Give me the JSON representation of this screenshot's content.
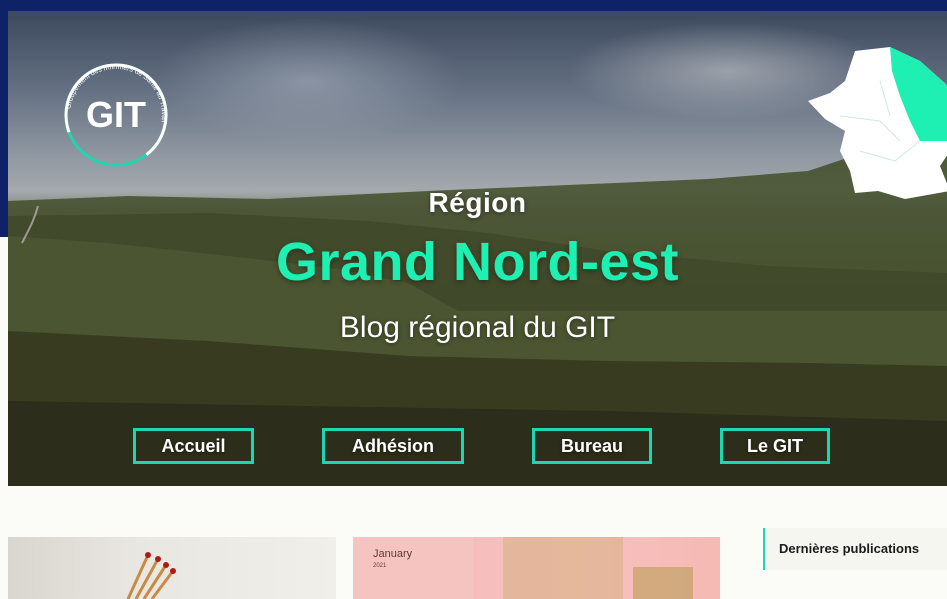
{
  "header": {
    "logo_text": "GIT",
    "logo_ring_text": "Groupement des Infirmiers de Santé au Travail"
  },
  "hero": {
    "region_label": "Région",
    "region_name": "Grand Nord-est",
    "subtitle": "Blog régional du GIT"
  },
  "nav": {
    "items": [
      {
        "label": "Accueil"
      },
      {
        "label": "Adhésion"
      },
      {
        "label": "Bureau"
      },
      {
        "label": "Le GIT"
      }
    ]
  },
  "posts": {
    "card2_calendar_text": "January",
    "card2_calendar_year": "2021"
  },
  "sidebar": {
    "title": "Dernières publications"
  },
  "colors": {
    "accent": "#1df0b2",
    "nav_border": "#1fd6b0",
    "navy": "#0e2268"
  },
  "icons": {
    "map": "france-map-icon"
  }
}
